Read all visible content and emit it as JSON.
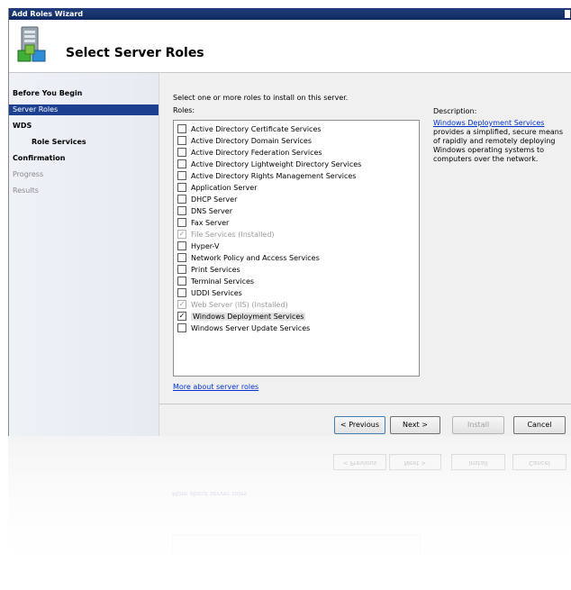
{
  "window": {
    "title": "Add Roles Wizard"
  },
  "header": {
    "title": "Select Server Roles",
    "icon": "server-roles-wizard-icon"
  },
  "nav": [
    {
      "label": "Before You Begin",
      "state": "normal"
    },
    {
      "label": "Server Roles",
      "state": "selected"
    },
    {
      "label": "WDS",
      "state": "normal"
    },
    {
      "label": "Role Services",
      "state": "sub"
    },
    {
      "label": "Confirmation",
      "state": "normal"
    },
    {
      "label": "Progress",
      "state": "disabled"
    },
    {
      "label": "Results",
      "state": "disabled"
    }
  ],
  "content": {
    "instructions": "Select one or more roles to install on this server.",
    "roles_label": "Roles:",
    "description_label": "Description:",
    "description_link": "Windows Deployment Services",
    "description_text": "provides a simplified, secure means of rapidly and remotely deploying Windows operating systems to computers over the network.",
    "more_link": "More about server roles"
  },
  "roles": [
    {
      "label": "Active Directory Certificate Services",
      "checked": false,
      "disabled": false
    },
    {
      "label": "Active Directory Domain Services",
      "checked": false,
      "disabled": false
    },
    {
      "label": "Active Directory Federation Services",
      "checked": false,
      "disabled": false
    },
    {
      "label": "Active Directory Lightweight Directory Services",
      "checked": false,
      "disabled": false
    },
    {
      "label": "Active Directory Rights Management Services",
      "checked": false,
      "disabled": false
    },
    {
      "label": "Application Server",
      "checked": false,
      "disabled": false
    },
    {
      "label": "DHCP Server",
      "checked": false,
      "disabled": false
    },
    {
      "label": "DNS Server",
      "checked": false,
      "disabled": false
    },
    {
      "label": "Fax Server",
      "checked": false,
      "disabled": false
    },
    {
      "label": "File Services  (Installed)",
      "checked": true,
      "disabled": true
    },
    {
      "label": "Hyper-V",
      "checked": false,
      "disabled": false
    },
    {
      "label": "Network Policy and Access Services",
      "checked": false,
      "disabled": false
    },
    {
      "label": "Print Services",
      "checked": false,
      "disabled": false
    },
    {
      "label": "Terminal Services",
      "checked": false,
      "disabled": false
    },
    {
      "label": "UDDI Services",
      "checked": false,
      "disabled": false
    },
    {
      "label": "Web Server (IIS)  (Installed)",
      "checked": true,
      "disabled": true
    },
    {
      "label": "Windows Deployment Services",
      "checked": true,
      "disabled": false,
      "selected": true
    },
    {
      "label": "Windows Server Update Services",
      "checked": false,
      "disabled": false
    }
  ],
  "buttons": {
    "previous": "< Previous",
    "next": "Next >",
    "install": "Install",
    "cancel": "Cancel"
  },
  "colors": {
    "titlebar": "#213f7c",
    "nav_selected": "#1c3f90",
    "link": "#0033cc"
  }
}
